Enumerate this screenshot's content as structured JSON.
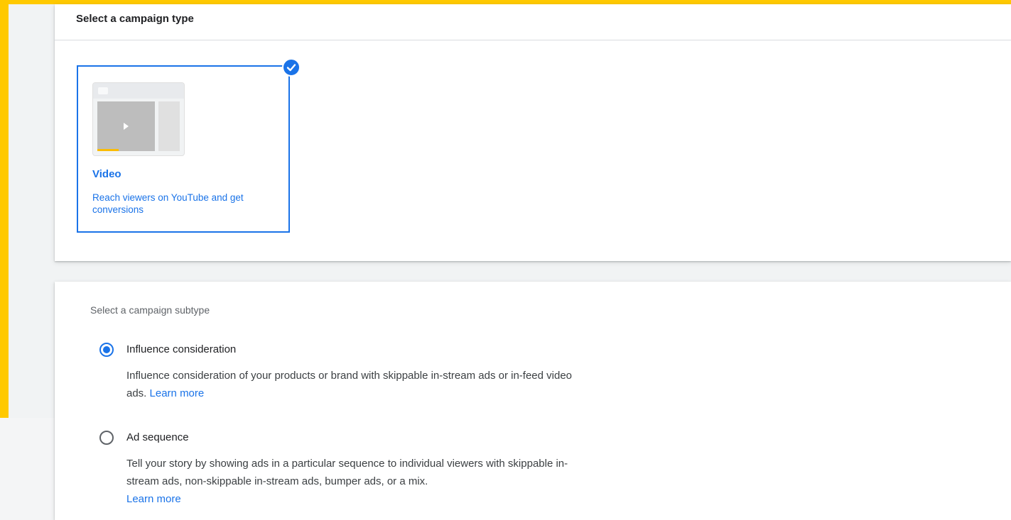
{
  "colors": {
    "frame": "#ffc900",
    "accent": "#1a73e8",
    "surface": "#f1f3f4"
  },
  "campaign_type": {
    "title": "Select a campaign type",
    "tile": {
      "icon": "video-player-illustration",
      "selected_icon": "check-circle-icon",
      "title": "Video",
      "description": "Reach viewers on YouTube and get conversions",
      "selected": true
    }
  },
  "subtype": {
    "heading": "Select a campaign subtype",
    "options": [
      {
        "label": "Influence consideration",
        "description": "Influence consideration of your products or brand with skippable in-stream ads or in-feed video ads.",
        "link": "Learn more",
        "selected": true
      },
      {
        "label": "Ad sequence",
        "description": "Tell your story by showing ads in a particular sequence to individual viewers with skippable in-stream ads, non-skippable in-stream ads, bumper ads, or a mix.",
        "link": "Learn more",
        "selected": false
      }
    ]
  }
}
